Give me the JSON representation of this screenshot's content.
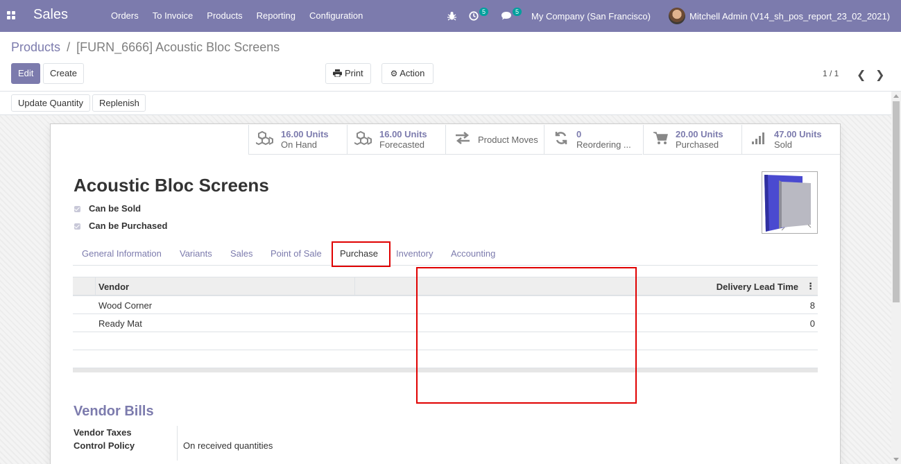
{
  "navbar": {
    "app_name": "Sales",
    "menu": [
      "Orders",
      "To Invoice",
      "Products",
      "Reporting",
      "Configuration"
    ],
    "activity_count": "5",
    "message_count": "5",
    "company": "My Company (San Francisco)",
    "user": "Mitchell Admin (V14_sh_pos_report_23_02_2021)"
  },
  "breadcrumb": {
    "parent": "Products",
    "separator": "/",
    "current": "[FURN_6666] Acoustic Bloc Screens"
  },
  "buttons": {
    "edit": "Edit",
    "create": "Create",
    "print": "Print",
    "action": "Action",
    "update_quantity": "Update Quantity",
    "replenish": "Replenish"
  },
  "pager": {
    "text": "1 / 1"
  },
  "smart_buttons": [
    {
      "value": "16.00 Units",
      "label": "On Hand",
      "icon": "cubes-icon"
    },
    {
      "value": "16.00 Units",
      "label": "Forecasted",
      "icon": "cubes-icon"
    },
    {
      "value": "",
      "label": "Product Moves",
      "icon": "exchange-icon"
    },
    {
      "value": "0",
      "label": "Reordering ...",
      "icon": "refresh-icon"
    },
    {
      "value": "20.00 Units",
      "label": "Purchased",
      "icon": "cart-icon"
    },
    {
      "value": "47.00 Units",
      "label": "Sold",
      "icon": "signal-icon"
    }
  ],
  "product": {
    "name": "Acoustic Bloc Screens",
    "can_be_sold": "Can be Sold",
    "can_be_purchased": "Can be Purchased"
  },
  "tabs": [
    "General Information",
    "Variants",
    "Sales",
    "Point of Sale",
    "Purchase",
    "Inventory",
    "Accounting"
  ],
  "active_tab": "Purchase",
  "vendor_table": {
    "headers": {
      "vendor": "Vendor",
      "lead_time": "Delivery Lead Time"
    },
    "rows": [
      {
        "vendor": "Wood Corner",
        "lead_time": "8"
      },
      {
        "vendor": "Ready Mat",
        "lead_time": "0"
      }
    ]
  },
  "vendor_bills": {
    "title": "Vendor Bills",
    "taxes_label": "Vendor Taxes",
    "control_label": "Control Policy",
    "control_value": "On received quantities"
  },
  "colors": {
    "primary": "#7c7bad",
    "highlight": "#e00000"
  }
}
